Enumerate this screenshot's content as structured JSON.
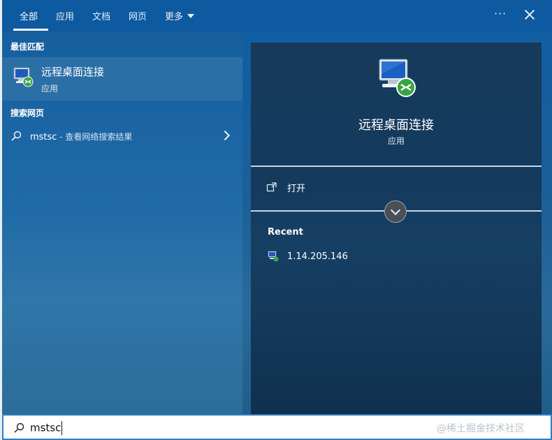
{
  "tabs": [
    {
      "label": "全部"
    },
    {
      "label": "应用"
    },
    {
      "label": "文档"
    },
    {
      "label": "网页"
    },
    {
      "label": "更多"
    }
  ],
  "left": {
    "best_match_title": "最佳匹配",
    "best_match": {
      "title": "远程桌面连接",
      "subtitle": "应用"
    },
    "web_title": "搜索网页",
    "web_query": "mstsc",
    "web_suffix": " - 查看网络搜索结果"
  },
  "right": {
    "app_title": "远程桌面连接",
    "app_subtitle": "应用",
    "open_label": "打开",
    "recent_title": "Recent",
    "recent_items": [
      "1.14.205.146"
    ]
  },
  "search": {
    "value": "mstsc"
  },
  "watermark": "@稀土掘金技术社区",
  "colors": {
    "accent": "#0d5aa0",
    "panel": "#153a5c",
    "border": "#2f7fc4"
  }
}
